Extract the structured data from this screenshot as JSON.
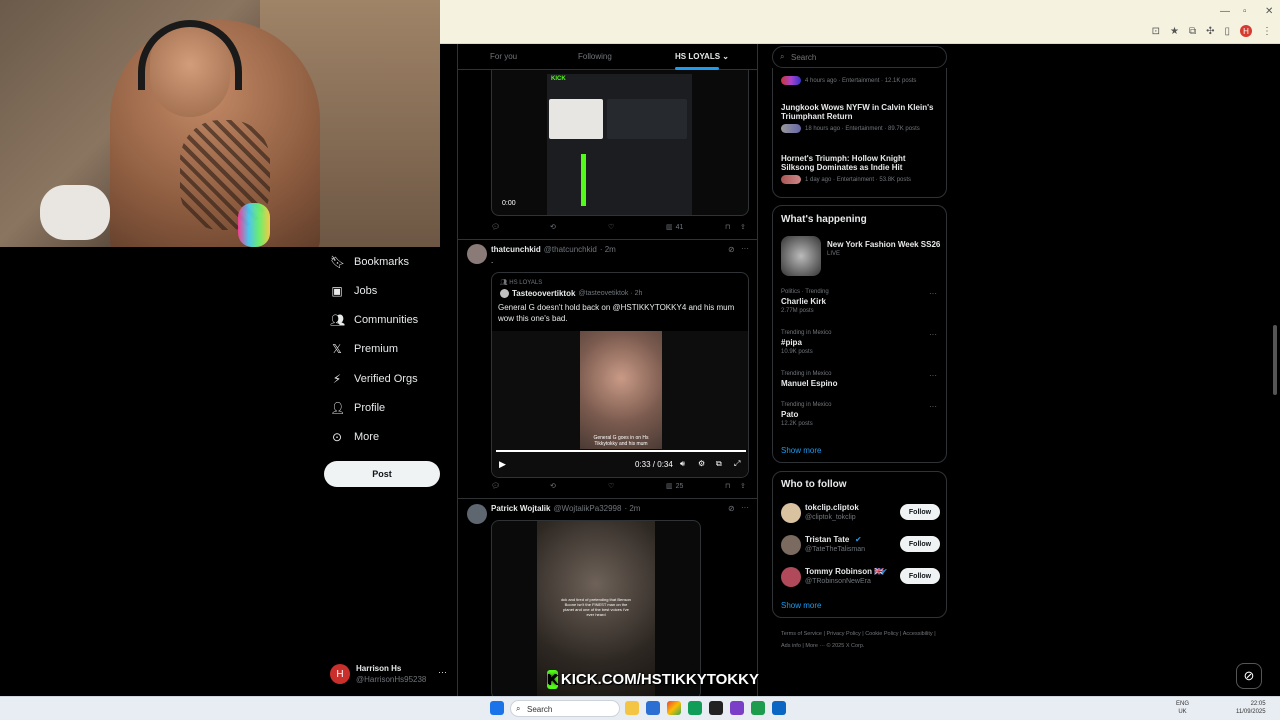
{
  "feed_tabs": {
    "for_you": "For you",
    "following": "Following",
    "hs_loyals": "HS LOYALS"
  },
  "nav": [
    {
      "label": "Bookmarks",
      "icon": "bookmark-icon"
    },
    {
      "label": "Jobs",
      "icon": "briefcase-icon"
    },
    {
      "label": "Communities",
      "icon": "people-icon"
    },
    {
      "label": "Premium",
      "icon": "x-logo-icon"
    },
    {
      "label": "Verified Orgs",
      "icon": "lightning-icon"
    },
    {
      "label": "Profile",
      "icon": "person-icon"
    },
    {
      "label": "More",
      "icon": "more-circle-icon"
    }
  ],
  "post_button": "Post",
  "account": {
    "name": "Harrison Hs",
    "handle": "@HarrisonHs95238",
    "avatar_letter": "H"
  },
  "tweet1": {
    "timestamp": "0:00",
    "views": "41",
    "kick_label": "KICK"
  },
  "tweet2": {
    "name": "thatcunchkid",
    "handle": "@thatcunchkid",
    "time": "· 2m",
    "text": ".",
    "quote_community": "HS LOYALS",
    "quote_name": "Tasteoovertiktok",
    "quote_handle": "@tasteovetiktok · 2h",
    "quote_text": "General G doesn't hold back on @HSTIKKYTOKKY4 and his mum wow this one's bad.",
    "caption": "General G goes in on Hs Tikkytokky and his mum",
    "video_time": "0:33 / 0:34",
    "views": "25"
  },
  "tweet3": {
    "name": "Patrick Wojtalik",
    "handle": "@WojtalikPa32998",
    "time": "· 2m",
    "caption": "dck and tired of pretending that Benson Boone isn't the FINEST man on the planet and one of the best voices i've ever heard"
  },
  "search": {
    "placeholder": "Search"
  },
  "news": [
    {
      "meta": "4 hours ago · Entertainment · 12.1K posts"
    },
    {
      "title": "Jungkook Wows NYFW in Calvin Klein's Triumphant Return",
      "meta": "18 hours ago · Entertainment · 89.7K posts"
    },
    {
      "title": "Hornet's Triumph: Hollow Knight Silksong Dominates as Indie Hit",
      "meta": "1 day ago · Entertainment · 53.8K posts"
    }
  ],
  "happening": {
    "heading": "What's happening",
    "event": {
      "title": "New York Fashion Week SS26",
      "status": "LIVE"
    },
    "trends": [
      {
        "context": "Politics · Trending",
        "title": "Charlie Kirk",
        "posts": "2.77M posts"
      },
      {
        "context": "Trending in Mexico",
        "title": "#pipa",
        "posts": "10.9K posts"
      },
      {
        "context": "Trending in Mexico",
        "title": "Manuel Espino",
        "posts": ""
      },
      {
        "context": "Trending in Mexico",
        "title": "Pato",
        "posts": "12.2K posts"
      }
    ],
    "show_more": "Show more"
  },
  "who_to_follow": {
    "heading": "Who to follow",
    "users": [
      {
        "name": "tokclip.cliptok",
        "handle": "@cliptok_tokclip",
        "button": "Follow"
      },
      {
        "name": "Tristan Tate",
        "handle": "@TateTheTalisman",
        "button": "Follow"
      },
      {
        "name": "Tommy Robinson 🇬🇧",
        "handle": "@TRobinsonNewEra",
        "button": "Follow"
      }
    ],
    "show_more": "Show more"
  },
  "footer_links": [
    "Terms of Service",
    "Privacy Policy",
    "Cookie Policy",
    "Accessibility",
    "Ads info",
    "More ···",
    "© 2025 X Corp."
  ],
  "overlay": {
    "kick_url": "KICK.COM/HSTIKKYTOKKY",
    "kick_letter": "K"
  },
  "taskbar": {
    "search": "Search",
    "lang_top": "ENG",
    "lang_bottom": "UK",
    "time": "22:05",
    "date": "11/09/2025"
  }
}
